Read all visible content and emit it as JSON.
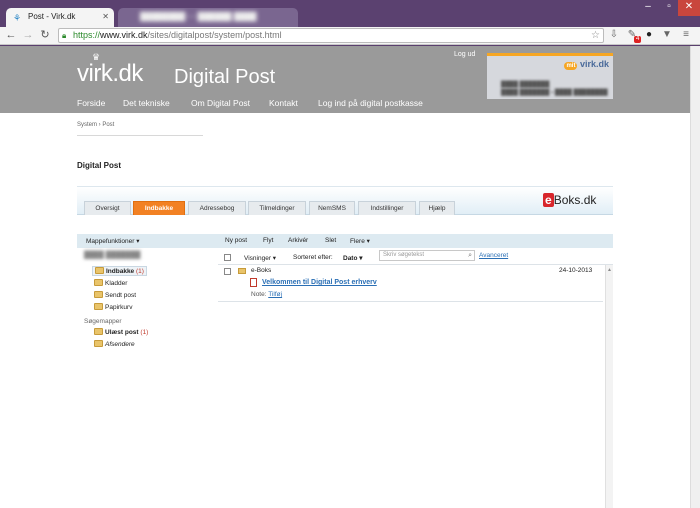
{
  "browser": {
    "tabs": [
      {
        "title": "Post - Virk.dk",
        "active": true
      },
      {
        "title": "",
        "active": false
      }
    ],
    "url": {
      "scheme": "https://",
      "host": "www.virk.dk",
      "path": "/sites/digitalpost/system/post.html"
    },
    "notification_count": "4"
  },
  "header": {
    "logo": "virk.dk",
    "title": "Digital Post",
    "logout": "Log ud",
    "nav": [
      "Forside",
      "Det tekniske",
      "Om Digital Post",
      "Kontakt",
      "Log ind på digital postkasse"
    ],
    "mitvirk_label": "virk.dk",
    "mitvirk_prefix": "mit"
  },
  "breadcrumb": "System › Post",
  "section_title": "Digital Post",
  "eboks": {
    "tabs": [
      "Oversigt",
      "Indbakke",
      "Adressebog",
      "Tilmeldinger",
      "NemSMS",
      "Indstillinger",
      "Hjælp"
    ],
    "active_tab": "Indbakke",
    "brand_e": "e",
    "brand_rest": "Boks.dk"
  },
  "actions": {
    "folder_functions": "Mappefunktioner ▾",
    "new_post": "Ny post",
    "move": "Flyt",
    "archive": "Arkivér",
    "delete": "Slet",
    "more": "Flere ▾"
  },
  "folders": {
    "items": [
      {
        "label": "Indbakke",
        "count": "(1)"
      },
      {
        "label": "Kladder",
        "count": ""
      },
      {
        "label": "Sendt post",
        "count": ""
      },
      {
        "label": "Papirkurv",
        "count": ""
      }
    ],
    "search_folders_title": "Søgemapper",
    "search_folders": [
      {
        "label": "Ulæst post",
        "count": "(1)"
      },
      {
        "label": "Afsendere",
        "count": ""
      }
    ]
  },
  "list": {
    "views": "Visninger ▾",
    "sort_prefix": "Sorteret efter:",
    "sort_value": "Dato ▾",
    "search_placeholder": "Skriv søgetekst",
    "advanced": "Avanceret"
  },
  "messages": [
    {
      "sender": "e-Boks",
      "date": "24-10-2013",
      "subject": "Velkommen til Digital Post erhverv",
      "note_label": "Note:",
      "note_link": "Tilføj"
    }
  ]
}
